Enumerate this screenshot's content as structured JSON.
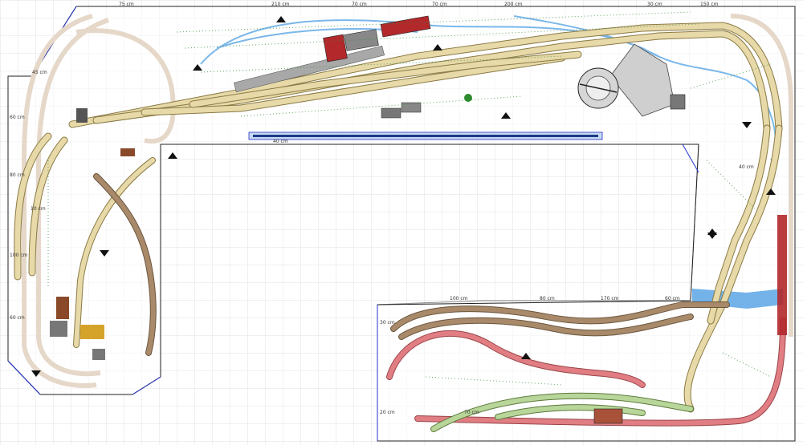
{
  "colors": {
    "grid": "#cfcfcf",
    "outline": "#222222",
    "blue_outline": "#2233cc",
    "track_beige": "#e7d9a8",
    "track_beige_edge": "#8a7a45",
    "track_brown": "#a88a6a",
    "track_pink": "#e07e84",
    "track_green": "#b9d69a",
    "track_faint": "#e9dcd0",
    "water": "#5aa6e6",
    "platform_gray": "#a8a8a8",
    "station_red": "#b2282b",
    "turntable": "#cfcfcf",
    "label_green": "#3a8a3a"
  },
  "dims": {
    "d75": "75 cm",
    "d210": "210 cm",
    "d70a": "70 cm",
    "d70b": "70 cm",
    "d200": "200 cm",
    "d30a": "30 cm",
    "d150": "150 cm",
    "d45": "45 cm",
    "d60a": "60 cm",
    "d80a": "80 cm",
    "d10a": "10 cm",
    "d100a": "100 cm",
    "d60b": "60 cm",
    "d40a": "40 cm",
    "d100b": "100 cm",
    "d80b": "80 cm",
    "d170": "170 cm",
    "d60c": "60 cm",
    "d20a": "20 cm",
    "d30b": "30 cm",
    "d70c": "70 cm",
    "d40b": "40 cm"
  },
  "icons": {
    "turntable": "turntable-icon",
    "tree": "tree-icon",
    "locomotive": "locomotive-icon",
    "arrow": "direction-arrow-icon"
  }
}
